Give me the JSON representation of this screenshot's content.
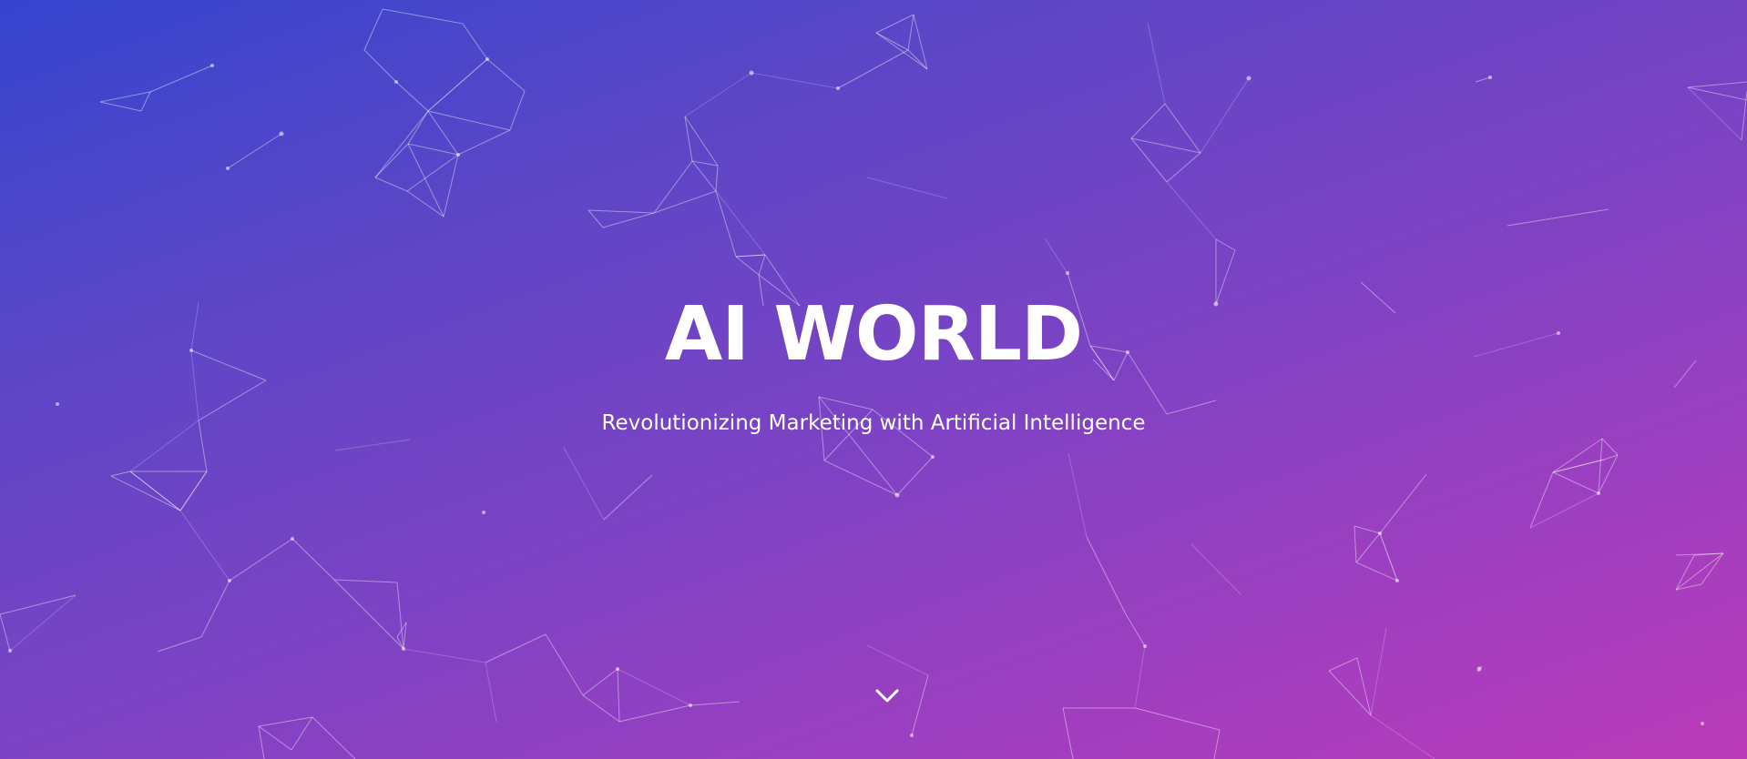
{
  "hero": {
    "title": "AI WORLD",
    "subtitle": "Revolutionizing Marketing with Artificial Intelligence",
    "scroll_icon": "chevron-down-icon"
  },
  "colors": {
    "gradient_start": "#3545cf",
    "gradient_end": "#bb3bb9",
    "text": "#ffffff"
  }
}
